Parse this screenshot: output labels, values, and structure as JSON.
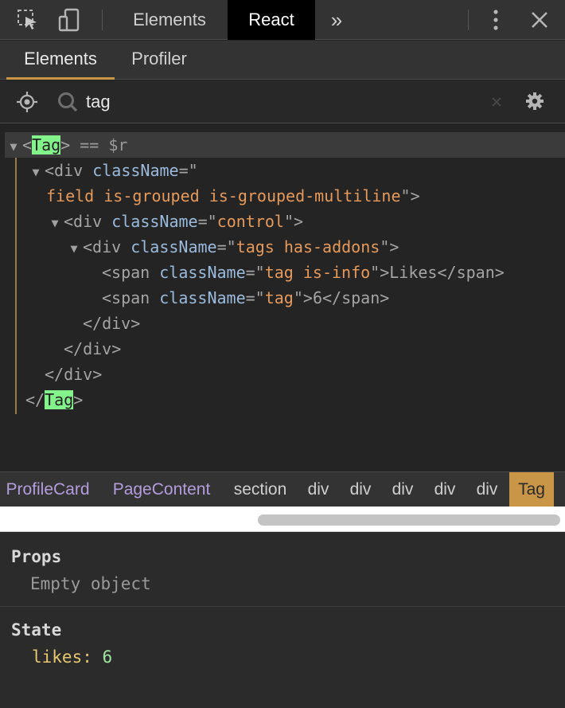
{
  "topbar": {
    "tabs": [
      "Elements",
      "React"
    ],
    "overflow": "»",
    "icons": [
      "inspect-icon",
      "device-toggle-icon",
      "more-icon",
      "close-icon"
    ]
  },
  "subtabs": [
    "Elements",
    "Profiler"
  ],
  "search": {
    "value": "tag"
  },
  "tree": {
    "root_name": "Tag",
    "root_suffix": " == $r",
    "lines": {
      "div1_open": "<div ",
      "div1_attr": "className",
      "div1_eq": "=\"",
      "div1_val": "field is-grouped is-grouped-multiline",
      "div1_close": "\">",
      "div2_open": "<div ",
      "div2_attr": "className",
      "div2_val": "control",
      "div3_open": "<div ",
      "div3_attr": "className",
      "div3_val": "tags has-addons",
      "span1_open": "<span ",
      "span1_attr": "className",
      "span1_val": "tag is-info",
      "span1_text": "Likes",
      "span2_open": "<span ",
      "span2_attr": "className",
      "span2_val": "tag",
      "span2_text": "6",
      "span_close": "</span>",
      "div_close": "</div>"
    }
  },
  "breadcrumb": [
    "ProfileCard",
    "PageContent",
    "section",
    "div",
    "div",
    "div",
    "div",
    "div",
    "Tag"
  ],
  "props": {
    "title": "Props",
    "empty": "Empty object"
  },
  "state": {
    "title": "State",
    "key": "likes",
    "value": "6"
  },
  "colors": {
    "accent": "#c99648",
    "component": "#b39ddb",
    "highlight": "#83f38c"
  }
}
